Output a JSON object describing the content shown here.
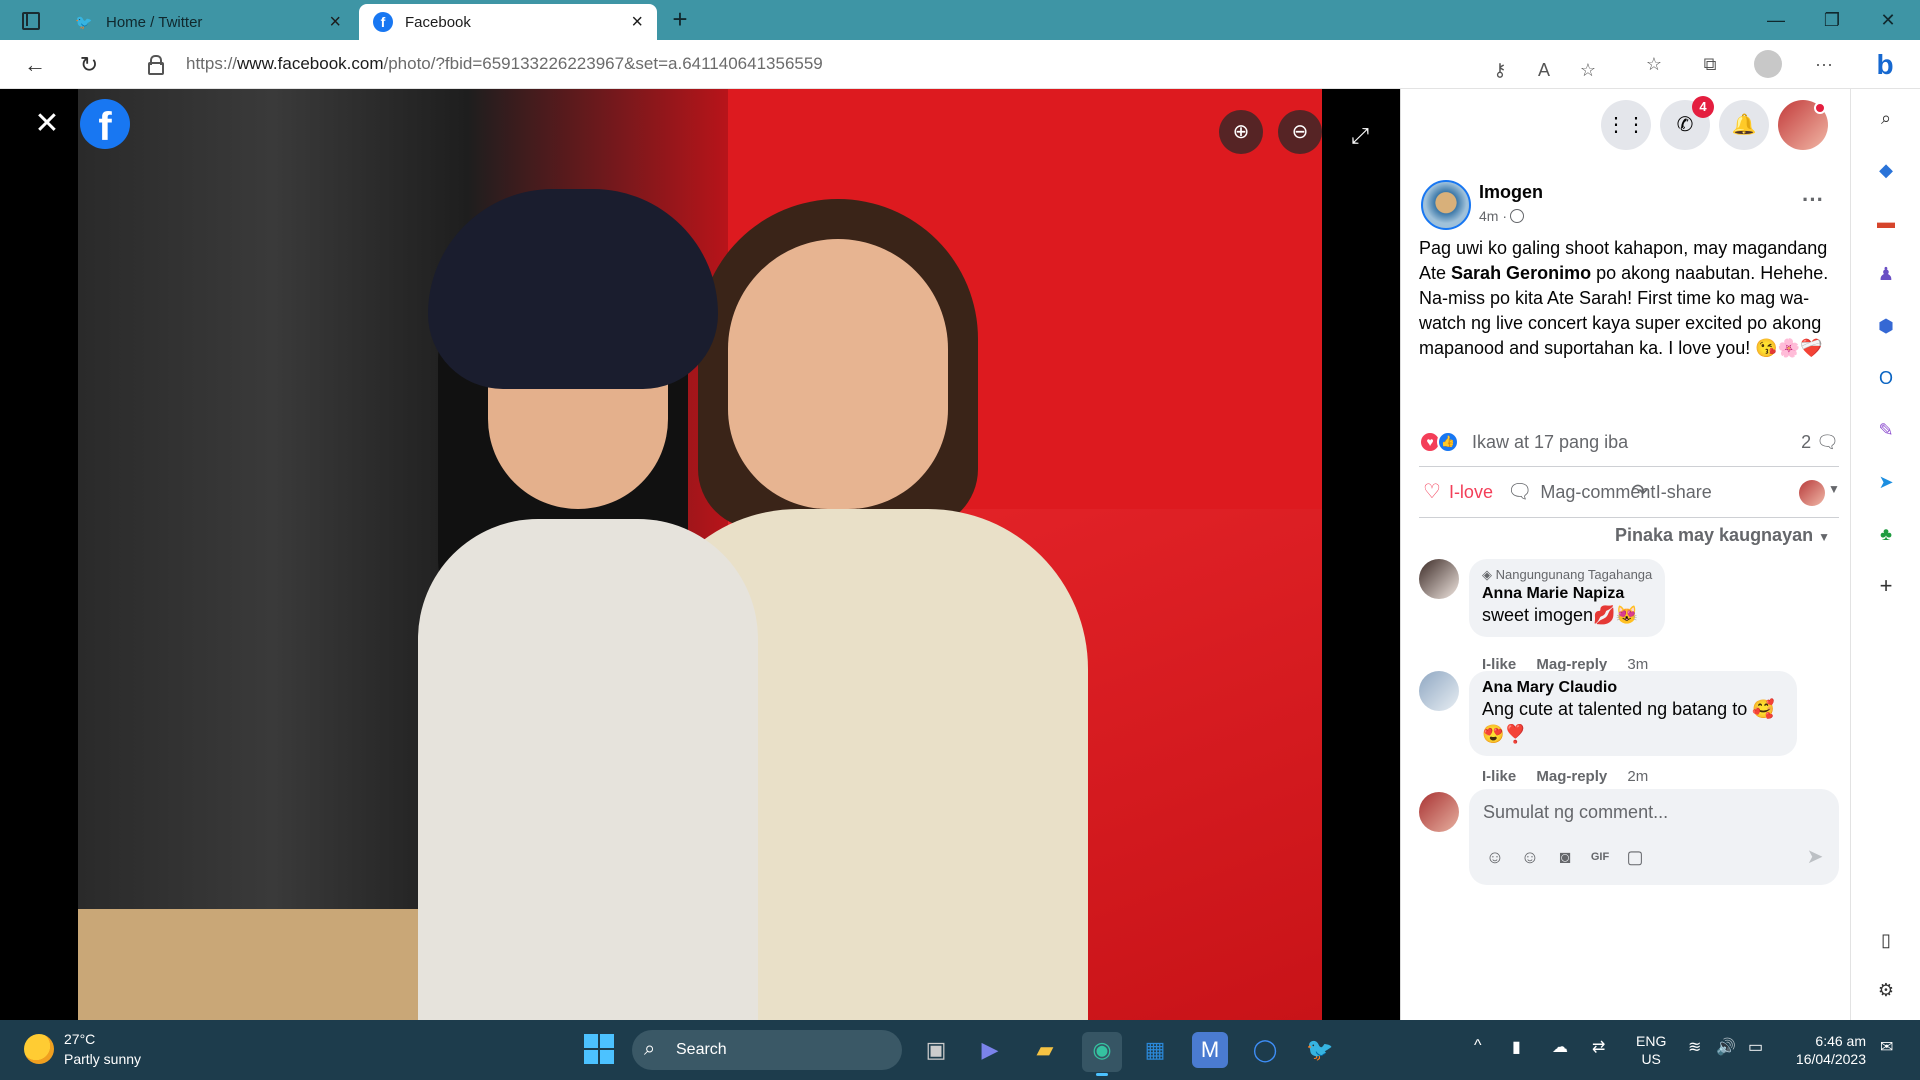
{
  "browser": {
    "tabs": [
      {
        "label": "Home / Twitter",
        "favicon": "twitter-bird-icon",
        "active": false
      },
      {
        "label": "Facebook",
        "favicon": "facebook-icon",
        "active": true
      }
    ],
    "url_prefix": "https://",
    "url_domain": "www.facebook.com",
    "url_path": "/photo/?fbid=659133226223967&set=a.641140641356559",
    "colors": {
      "tabbar": "#3e95a5"
    }
  },
  "viewer": {
    "zoom_in_icon": "zoom-in-icon",
    "zoom_out_icon": "zoom-out-icon",
    "fullscreen_icon": "fullscreen-icon"
  },
  "header": {
    "messenger_badge": "4"
  },
  "post": {
    "author": "Imogen",
    "time": "4m ·",
    "text_before": "Pag uwi ko galing shoot kahapon, may magandang Ate ",
    "mention": "Sarah Geronimo",
    "text_after": " po akong naabutan. Hehehe. Na-miss po kita Ate Sarah! First time ko mag wa-watch ng live concert kaya super excited po akong mapanood and suportahan ka. I love you! 😘🌸❤️‍🩹",
    "reactions_text": "Ikaw at 17 pang iba",
    "comment_count": "2",
    "actions": {
      "love": "I-love",
      "comment": "Mag-comment",
      "share": "I-share"
    },
    "sort_label": "Pinaka may kaugnayan"
  },
  "comments": [
    {
      "badge": "Nangungunang Tagahanga",
      "author": "Anna Marie Napiza",
      "text": "sweet imogen💋😻",
      "like": "I-like",
      "reply": "Mag-reply",
      "time": "3m"
    },
    {
      "badge": "",
      "author": "Ana Mary Claudio",
      "text": "Ang cute at talented ng batang to 🥰😍❣️",
      "like": "I-like",
      "reply": "Mag-reply",
      "time": "2m"
    }
  ],
  "composer": {
    "placeholder": "Sumulat ng comment..."
  },
  "taskbar": {
    "temperature": "27°C",
    "weather": "Partly sunny",
    "search": "Search",
    "lang_top": "ENG",
    "lang_bottom": "US",
    "time": "6:46 am",
    "date": "16/04/2023"
  }
}
